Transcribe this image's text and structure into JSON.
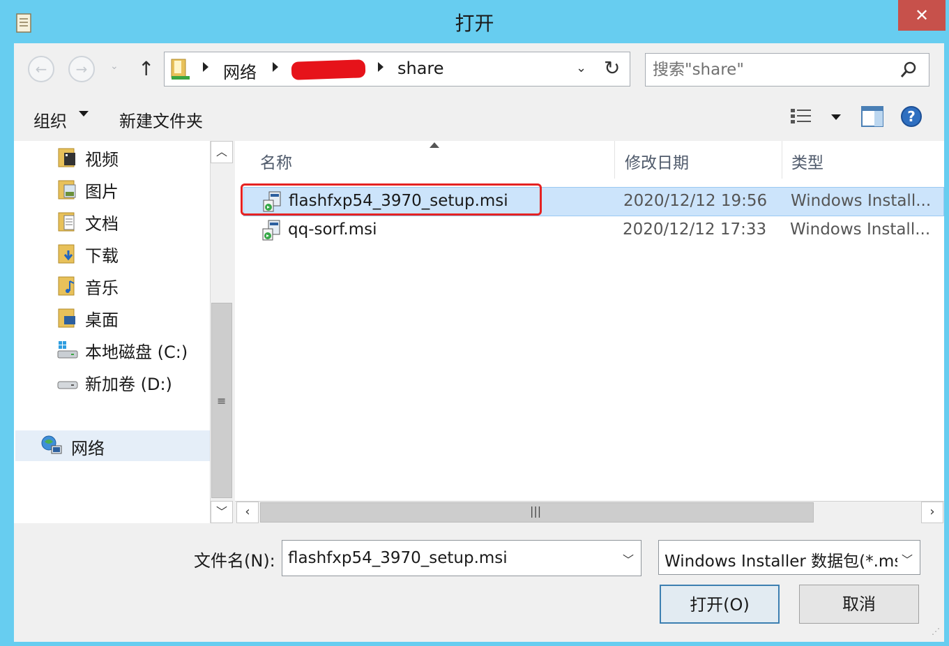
{
  "window": {
    "title": "打开",
    "close_glyph": "✕"
  },
  "nav": {
    "back_glyph": "←",
    "forward_glyph": "→",
    "recent_glyph": "⌄",
    "up_glyph": "↑"
  },
  "address": {
    "crumbs": [
      "网络",
      "share"
    ],
    "refresh_glyph": "↻",
    "dropdown_glyph": "⌄"
  },
  "search": {
    "placeholder": "搜索\"share\""
  },
  "toolbar": {
    "organize_label": "组织",
    "new_folder_label": "新建文件夹"
  },
  "sidebar": {
    "items": [
      {
        "label": "视频"
      },
      {
        "label": "图片"
      },
      {
        "label": "文档"
      },
      {
        "label": "下载"
      },
      {
        "label": "音乐"
      },
      {
        "label": "桌面"
      },
      {
        "label": "本地磁盘 (C:)"
      },
      {
        "label": "新加卷 (D:)"
      }
    ],
    "network_label": "网络"
  },
  "columns": {
    "name": "名称",
    "date": "修改日期",
    "type": "类型"
  },
  "files": [
    {
      "name": "flashfxp54_3970_setup.msi",
      "date": "2020/12/12 19:56",
      "type": "Windows Install..."
    },
    {
      "name": "qq-sorf.msi",
      "date": "2020/12/12 17:33",
      "type": "Windows Install..."
    }
  ],
  "bottom": {
    "filename_label": "文件名(N):",
    "filename_value": "flashfxp54_3970_setup.msi",
    "filetype_value": "Windows Installer 数据包(*.msi)",
    "open_label": "打开(O)",
    "cancel_label": "取消"
  },
  "colors": {
    "title_bar": "#67cdf0",
    "close_button": "#c7514b",
    "selection": "#cce4fb",
    "highlight_box": "#e52222"
  }
}
